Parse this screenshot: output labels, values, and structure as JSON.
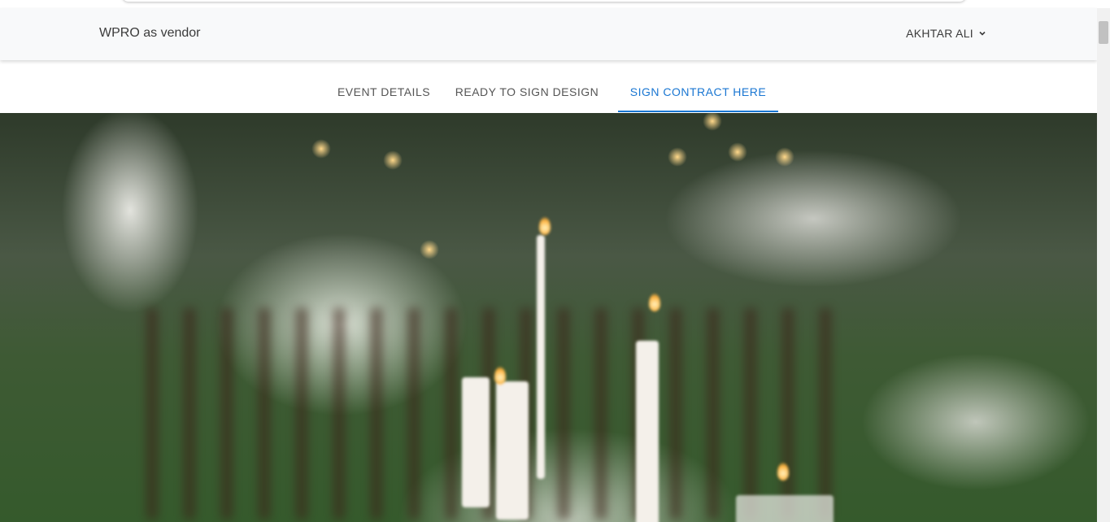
{
  "navbar": {
    "brand": "WPRO as vendor",
    "user_name": "AKHTAR ALI",
    "user_menu_icon": "chevron-down-icon"
  },
  "tabs": [
    {
      "label": "EVENT DETAILS",
      "active": false
    },
    {
      "label": "READY TO SIGN DESIGN",
      "active": false
    },
    {
      "label": "SIGN CONTRACT HERE",
      "active": true
    }
  ],
  "colors": {
    "accent": "#1976d2",
    "navbar_bg": "#f8f9fa",
    "tab_text": "#555555"
  },
  "hero": {
    "image": "blurred outdoor wedding reception tables with candles and flowers"
  }
}
